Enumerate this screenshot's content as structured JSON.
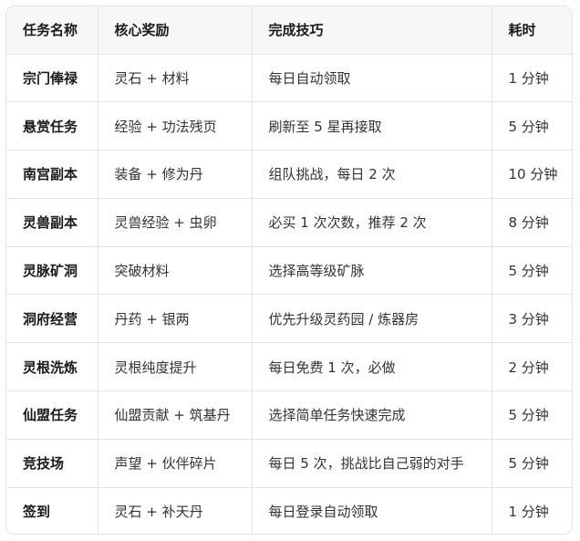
{
  "table": {
    "headers": [
      "任务名称",
      "核心奖励",
      "完成技巧",
      "耗时"
    ],
    "rows": [
      [
        "宗门俸禄",
        "灵石 + 材料",
        "每日自动领取",
        "1 分钟"
      ],
      [
        "悬赏任务",
        "经验 + 功法残页",
        "刷新至 5 星再接取",
        "5 分钟"
      ],
      [
        "南宫副本",
        "装备 + 修为丹",
        "组队挑战，每日 2 次",
        "10 分钟"
      ],
      [
        "灵兽副本",
        "灵兽经验 + 虫卵",
        "必买 1 次次数，推荐 2 次",
        "8 分钟"
      ],
      [
        "灵脉矿洞",
        "突破材料",
        "选择高等级矿脉",
        "5 分钟"
      ],
      [
        "洞府经营",
        "丹药 + 银两",
        "优先升级灵药园 / 炼器房",
        "3 分钟"
      ],
      [
        "灵根洗炼",
        "灵根纯度提升",
        "每日免费 1 次，必做",
        "2 分钟"
      ],
      [
        "仙盟任务",
        "仙盟贡献 + 筑基丹",
        "选择简单任务快速完成",
        "5 分钟"
      ],
      [
        "竞技场",
        "声望 + 伙伴碎片",
        "每日 5 次，挑战比自己弱的对手",
        "5 分钟"
      ],
      [
        "签到",
        "灵石 + 补天丹",
        "每日登录自动领取",
        "1 分钟"
      ]
    ]
  }
}
